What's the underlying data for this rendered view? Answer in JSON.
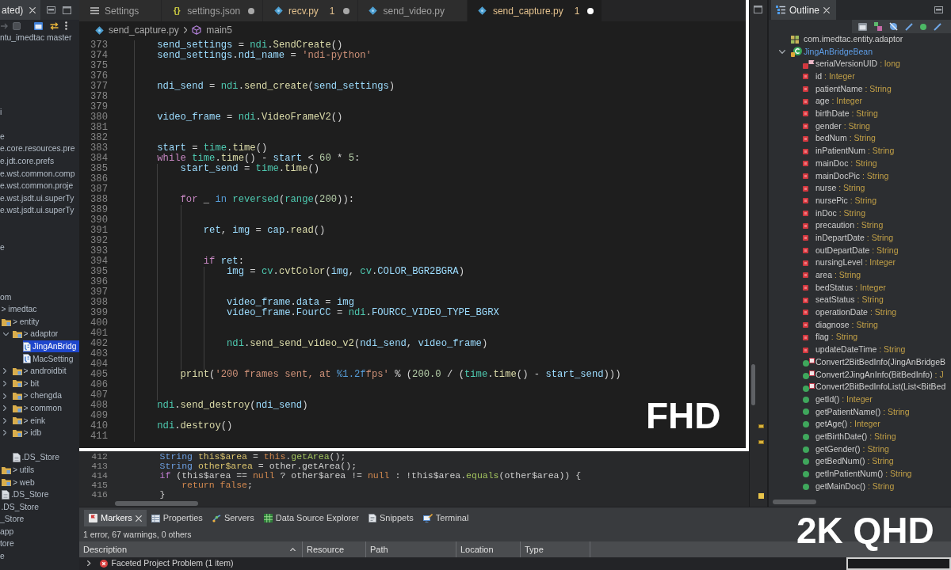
{
  "project_explorer": {
    "tab": {
      "label": "ated)"
    },
    "tree": [
      {
        "label": "ntu_imedtac master",
        "kind": "text",
        "selected": false
      },
      {
        "label": "i",
        "kind": "text",
        "selected": false
      },
      {
        "label": "e",
        "kind": "text",
        "selected": false
      },
      {
        "label": "e.core.resources.pre",
        "kind": "text",
        "selected": false
      },
      {
        "label": "e.jdt.core.prefs",
        "kind": "text",
        "selected": false
      },
      {
        "label": "e.wst.common.comp",
        "kind": "text",
        "selected": false
      },
      {
        "label": "e.wst.common.proje",
        "kind": "text",
        "selected": false
      },
      {
        "label": "e.wst.jsdt.ui.superTy",
        "kind": "text",
        "selected": false
      },
      {
        "label": "e.wst.jsdt.ui.superTy",
        "kind": "text",
        "selected": false
      },
      {
        "label": "e",
        "kind": "text",
        "selected": false
      },
      {
        "label": "om",
        "kind": "text",
        "selected": false,
        "children": [
          {
            "label": "> imedtac",
            "kind": "text",
            "selected": false,
            "children": [
              {
                "label": "> entity",
                "kind": "folder",
                "selected": false,
                "children": [
                  {
                    "label": "> adaptor",
                    "kind": "folder",
                    "expanded": true,
                    "selected": false,
                    "children": [
                      {
                        "label": "JingAnBridg",
                        "kind": "java",
                        "selected": true
                      },
                      {
                        "label": "MacSetting",
                        "kind": "java",
                        "selected": false
                      }
                    ]
                  },
                  {
                    "label": "> androidbit",
                    "kind": "folder",
                    "expanded": false,
                    "selected": false
                  },
                  {
                    "label": "> bit",
                    "kind": "folder",
                    "expanded": false,
                    "selected": false
                  },
                  {
                    "label": "> chengda",
                    "kind": "folder",
                    "expanded": false,
                    "selected": false
                  },
                  {
                    "label": "> common",
                    "kind": "folder",
                    "expanded": false,
                    "selected": false
                  },
                  {
                    "label": "> eink",
                    "kind": "folder",
                    "expanded": false,
                    "selected": false
                  },
                  {
                    "label": "> idb",
                    "kind": "folder",
                    "expanded": false,
                    "selected": false
                  },
                  {
                    "label": ".DS_Store",
                    "kind": "file",
                    "selected": false
                  }
                ]
              },
              {
                "label": "> utils",
                "kind": "folder",
                "selected": false
              },
              {
                "label": "> web",
                "kind": "folder",
                "selected": false
              },
              {
                "label": ".DS_Store",
                "kind": "file",
                "selected": false
              }
            ]
          },
          {
            "label": ".DS_Store",
            "kind": "text",
            "selected": false
          }
        ]
      },
      {
        "label": "_Store",
        "kind": "text",
        "selected": false
      },
      {
        "label": "app",
        "kind": "text",
        "selected": false
      },
      {
        "label": "tore",
        "kind": "text",
        "selected": false
      },
      {
        "label": "e",
        "kind": "text",
        "selected": false
      }
    ]
  },
  "editor": {
    "lines": [
      {
        "number": "412",
        "tokens": [
          {
            "text": "    String ",
            "kind": "type"
          },
          {
            "text": "this$area",
            "kind": "local"
          },
          {
            "text": " = ",
            "kind": "plain"
          },
          {
            "text": "this",
            "kind": "keyword"
          },
          {
            "text": ".",
            "kind": "plain"
          },
          {
            "text": "getArea",
            "kind": "method"
          },
          {
            "text": "();",
            "kind": "plain"
          }
        ]
      },
      {
        "number": "413",
        "tokens": [
          {
            "text": "    String ",
            "kind": "type"
          },
          {
            "text": "other$area",
            "kind": "local"
          },
          {
            "text": " = other.getArea();",
            "kind": "plain"
          }
        ]
      },
      {
        "number": "414",
        "tokens": [
          {
            "text": "    if",
            "kind": "control"
          },
          {
            "text": " (this$area == ",
            "kind": "plain"
          },
          {
            "text": "null",
            "kind": "keyword"
          },
          {
            "text": " ? other$area != ",
            "kind": "plain"
          },
          {
            "text": "null",
            "kind": "keyword"
          },
          {
            "text": " : !this$area.",
            "kind": "plain"
          },
          {
            "text": "equals",
            "kind": "method"
          },
          {
            "text": "(other$area)) {",
            "kind": "plain"
          }
        ]
      },
      {
        "number": "415",
        "tokens": [
          {
            "text": "        return false",
            "kind": "keyword"
          },
          {
            "text": ";",
            "kind": "plain"
          }
        ]
      },
      {
        "number": "416",
        "tokens": [
          {
            "text": "    }",
            "kind": "plain"
          }
        ]
      }
    ]
  },
  "outline": {
    "tab": {
      "label": "Outline"
    },
    "tree": [
      {
        "label": "com.imedtac.entity.adaptor",
        "kind": "package",
        "selected": false
      },
      {
        "label": "JingAnBridgeBean",
        "kind": "class",
        "expanded": true,
        "selected": true,
        "children": [
          {
            "label": "serialVersionUID",
            "type": ": long",
            "kind": "static_field",
            "selected": false
          },
          {
            "label": "id",
            "type": ": Integer",
            "kind": "field",
            "selected": false
          },
          {
            "label": "patientName",
            "type": ": String",
            "kind": "field",
            "selected": false
          },
          {
            "label": "age",
            "type": ": Integer",
            "kind": "field",
            "selected": false
          },
          {
            "label": "birthDate",
            "type": ": String",
            "kind": "field",
            "selected": false
          },
          {
            "label": "gender",
            "type": ": String",
            "kind": "field",
            "selected": false
          },
          {
            "label": "bedNum",
            "type": ": String",
            "kind": "field",
            "selected": false
          },
          {
            "label": "inPatientNum",
            "type": ": String",
            "kind": "field",
            "selected": false
          },
          {
            "label": "mainDoc",
            "type": ": String",
            "kind": "field",
            "selected": false
          },
          {
            "label": "mainDocPic",
            "type": ": String",
            "kind": "field",
            "selected": false
          },
          {
            "label": "nurse",
            "type": ": String",
            "kind": "field",
            "selected": false
          },
          {
            "label": "nursePic",
            "type": ": String",
            "kind": "field",
            "selected": false
          },
          {
            "label": "inDoc",
            "type": ": String",
            "kind": "field",
            "selected": false
          },
          {
            "label": "precaution",
            "type": ": String",
            "kind": "field",
            "selected": false
          },
          {
            "label": "inDepartDate",
            "type": ": String",
            "kind": "field",
            "selected": false
          },
          {
            "label": "outDepartDate",
            "type": ": String",
            "kind": "field",
            "selected": false
          },
          {
            "label": "nursingLevel",
            "type": ": Integer",
            "kind": "field",
            "selected": false
          },
          {
            "label": "area",
            "type": ": String",
            "kind": "field",
            "selected": false
          },
          {
            "label": "bedStatus",
            "type": ": Integer",
            "kind": "field",
            "selected": false
          },
          {
            "label": "seatStatus",
            "type": ": String",
            "kind": "field",
            "selected": false
          },
          {
            "label": "operationDate",
            "type": ": String",
            "kind": "field",
            "selected": false
          },
          {
            "label": "diagnose",
            "type": ": String",
            "kind": "field",
            "selected": false
          },
          {
            "label": "flag",
            "type": ": String",
            "kind": "field",
            "selected": false
          },
          {
            "label": "updateDateTime",
            "type": ": String",
            "kind": "field",
            "selected": false
          },
          {
            "label": "Convert2BitBedInfo(JingAnBridgeB",
            "kind": "static_method",
            "selected": false
          },
          {
            "label": "Convert2JingAnInfo(BitBedInfo)",
            "type": ": J",
            "kind": "static_method",
            "selected": false
          },
          {
            "label": "Convert2BitBedInfoList(List<BitBed",
            "kind": "static_method",
            "selected": false
          },
          {
            "label": "getId()",
            "type": ": Integer",
            "kind": "method",
            "selected": false
          },
          {
            "label": "getPatientName()",
            "type": ": String",
            "kind": "method",
            "selected": false
          },
          {
            "label": "getAge()",
            "type": ": Integer",
            "kind": "method",
            "selected": false
          },
          {
            "label": "getBirthDate()",
            "type": ": String",
            "kind": "method",
            "selected": false
          },
          {
            "label": "getGender()",
            "type": ": String",
            "kind": "method",
            "selected": false
          },
          {
            "label": "getBedNum()",
            "type": ": String",
            "kind": "method",
            "selected": false
          },
          {
            "label": "getInPatientNum()",
            "type": ": String",
            "kind": "method",
            "selected": false
          },
          {
            "label": "getMainDoc()",
            "type": ": String",
            "kind": "method",
            "selected": false
          }
        ]
      }
    ]
  },
  "bottom_panel": {
    "tabs": [
      {
        "label": "Markers",
        "kind": "markers",
        "selected": true,
        "closable": true
      },
      {
        "label": "Properties",
        "kind": "properties",
        "selected": false,
        "closable": false
      },
      {
        "label": "Servers",
        "kind": "servers",
        "selected": false,
        "closable": false
      },
      {
        "label": "Data Source Explorer",
        "kind": "database",
        "selected": false,
        "closable": false
      },
      {
        "label": "Snippets",
        "kind": "snippets",
        "selected": false,
        "closable": false
      },
      {
        "label": "Terminal",
        "kind": "terminal",
        "selected": false,
        "closable": false
      }
    ],
    "summary": "1 error, 67 warnings, 0 others",
    "columns": [
      {
        "label": "Description",
        "sorted": true
      },
      {
        "label": "Resource",
        "sorted": false
      },
      {
        "label": "Path",
        "sorted": false
      },
      {
        "label": "Location",
        "sorted": false
      },
      {
        "label": "Type",
        "sorted": false
      }
    ],
    "rows": [
      {
        "description": "Faceted Project Problem (1 item)",
        "kind": "error",
        "expanded": false
      }
    ]
  },
  "vscode": {
    "tabs": [
      {
        "label": "Settings",
        "kind": "settings",
        "selected": false,
        "warning": false,
        "unsaved": false
      },
      {
        "label": "settings.json",
        "kind": "json",
        "glyph": "{}",
        "selected": false,
        "warning": false,
        "unsaved": true
      },
      {
        "label": "recv.py",
        "kind": "python",
        "problems": "1",
        "selected": false,
        "warning": true,
        "unsaved": true
      },
      {
        "label": "send_video.py",
        "kind": "python",
        "selected": false,
        "warning": false,
        "unsaved": false
      },
      {
        "label": "send_capture.py",
        "kind": "python",
        "problems": "1",
        "selected": true,
        "warning": true,
        "unsaved": true
      }
    ],
    "breadcrumb": {
      "file": "send_capture.py",
      "symbol": "main5"
    },
    "lines": [
      {
        "number": "373",
        "tokens": [
          {
            "text": "    send_settings",
            "kind": "var"
          },
          {
            "text": " = ",
            "kind": "op"
          },
          {
            "text": "ndi",
            "kind": "mod"
          },
          {
            "text": ".",
            "kind": "op"
          },
          {
            "text": "SendCreate",
            "kind": "fn"
          },
          {
            "text": "()",
            "kind": "op"
          }
        ]
      },
      {
        "number": "374",
        "tokens": [
          {
            "text": "    send_settings",
            "kind": "var"
          },
          {
            "text": ".",
            "kind": "op"
          },
          {
            "text": "ndi_name",
            "kind": "var"
          },
          {
            "text": " = ",
            "kind": "op"
          },
          {
            "text": "'ndi-python'",
            "kind": "str"
          }
        ]
      },
      {
        "number": "375"
      },
      {
        "number": "376"
      },
      {
        "number": "377",
        "tokens": [
          {
            "text": "    ndi_send",
            "kind": "var"
          },
          {
            "text": " = ",
            "kind": "op"
          },
          {
            "text": "ndi",
            "kind": "mod"
          },
          {
            "text": ".",
            "kind": "op"
          },
          {
            "text": "send_create",
            "kind": "fn"
          },
          {
            "text": "(",
            "kind": "op"
          },
          {
            "text": "send_settings",
            "kind": "var"
          },
          {
            "text": ")",
            "kind": "op"
          }
        ]
      },
      {
        "number": "378"
      },
      {
        "number": "379"
      },
      {
        "number": "380",
        "tokens": [
          {
            "text": "    video_frame",
            "kind": "var"
          },
          {
            "text": " = ",
            "kind": "op"
          },
          {
            "text": "ndi",
            "kind": "mod"
          },
          {
            "text": ".",
            "kind": "op"
          },
          {
            "text": "VideoFrameV2",
            "kind": "fn"
          },
          {
            "text": "()",
            "kind": "op"
          }
        ]
      },
      {
        "number": "381"
      },
      {
        "number": "382"
      },
      {
        "number": "383",
        "tokens": [
          {
            "text": "    start",
            "kind": "var"
          },
          {
            "text": " = ",
            "kind": "op"
          },
          {
            "text": "time",
            "kind": "mod"
          },
          {
            "text": ".",
            "kind": "op"
          },
          {
            "text": "time",
            "kind": "fn"
          },
          {
            "text": "()",
            "kind": "op"
          }
        ]
      },
      {
        "number": "384",
        "tokens": [
          {
            "text": "    while ",
            "kind": "kw"
          },
          {
            "text": "time",
            "kind": "mod"
          },
          {
            "text": ".",
            "kind": "op"
          },
          {
            "text": "time",
            "kind": "fn"
          },
          {
            "text": "() - ",
            "kind": "op"
          },
          {
            "text": "start",
            "kind": "var"
          },
          {
            "text": " < ",
            "kind": "op"
          },
          {
            "text": "60",
            "kind": "num"
          },
          {
            "text": " * ",
            "kind": "op"
          },
          {
            "text": "5",
            "kind": "num"
          },
          {
            "text": ":",
            "kind": "op"
          }
        ]
      },
      {
        "number": "385",
        "tokens": [
          {
            "text": "        start_send",
            "kind": "var"
          },
          {
            "text": " = ",
            "kind": "op"
          },
          {
            "text": "time",
            "kind": "mod"
          },
          {
            "text": ".",
            "kind": "op"
          },
          {
            "text": "time",
            "kind": "fn"
          },
          {
            "text": "()",
            "kind": "op"
          }
        ]
      },
      {
        "number": "386"
      },
      {
        "number": "387"
      },
      {
        "number": "388",
        "tokens": [
          {
            "text": "        for",
            "kind": "kw"
          },
          {
            "text": " _ ",
            "kind": "op"
          },
          {
            "text": "in ",
            "kind": "kw2"
          },
          {
            "text": "reversed",
            "kind": "mod"
          },
          {
            "text": "(",
            "kind": "op"
          },
          {
            "text": "range",
            "kind": "mod"
          },
          {
            "text": "(",
            "kind": "op"
          },
          {
            "text": "200",
            "kind": "num"
          },
          {
            "text": ")):",
            "kind": "op"
          }
        ]
      },
      {
        "number": "389"
      },
      {
        "number": "390"
      },
      {
        "number": "391",
        "tokens": [
          {
            "text": "            ret",
            "kind": "var"
          },
          {
            "text": ", ",
            "kind": "op"
          },
          {
            "text": "img",
            "kind": "var"
          },
          {
            "text": " = ",
            "kind": "op"
          },
          {
            "text": "cap",
            "kind": "var"
          },
          {
            "text": ".",
            "kind": "op"
          },
          {
            "text": "read",
            "kind": "fn"
          },
          {
            "text": "()",
            "kind": "op"
          }
        ]
      },
      {
        "number": "392"
      },
      {
        "number": "393"
      },
      {
        "number": "394",
        "tokens": [
          {
            "text": "            if ",
            "kind": "kw"
          },
          {
            "text": "ret",
            "kind": "var"
          },
          {
            "text": ":",
            "kind": "op"
          }
        ]
      },
      {
        "number": "395",
        "tokens": [
          {
            "text": "                img",
            "kind": "var"
          },
          {
            "text": " = ",
            "kind": "op"
          },
          {
            "text": "cv",
            "kind": "mod"
          },
          {
            "text": ".",
            "kind": "op"
          },
          {
            "text": "cvtColor",
            "kind": "fn"
          },
          {
            "text": "(",
            "kind": "op"
          },
          {
            "text": "img",
            "kind": "var"
          },
          {
            "text": ", ",
            "kind": "op"
          },
          {
            "text": "cv",
            "kind": "mod"
          },
          {
            "text": ".",
            "kind": "op"
          },
          {
            "text": "COLOR_BGR2BGRA",
            "kind": "var"
          },
          {
            "text": ")",
            "kind": "op"
          }
        ]
      },
      {
        "number": "396"
      },
      {
        "number": "397"
      },
      {
        "number": "398",
        "tokens": [
          {
            "text": "                video_frame",
            "kind": "var"
          },
          {
            "text": ".",
            "kind": "op"
          },
          {
            "text": "data",
            "kind": "var"
          },
          {
            "text": " = ",
            "kind": "op"
          },
          {
            "text": "img",
            "kind": "var"
          }
        ]
      },
      {
        "number": "399",
        "tokens": [
          {
            "text": "                video_frame",
            "kind": "var"
          },
          {
            "text": ".",
            "kind": "op"
          },
          {
            "text": "FourCC",
            "kind": "var"
          },
          {
            "text": " = ",
            "kind": "op"
          },
          {
            "text": "ndi",
            "kind": "mod"
          },
          {
            "text": ".",
            "kind": "op"
          },
          {
            "text": "FOURCC_VIDEO_TYPE_BGRX",
            "kind": "var"
          }
        ]
      },
      {
        "number": "400"
      },
      {
        "number": "401"
      },
      {
        "number": "402",
        "tokens": [
          {
            "text": "                ndi",
            "kind": "mod"
          },
          {
            "text": ".",
            "kind": "op"
          },
          {
            "text": "send_send_video_v2",
            "kind": "fn"
          },
          {
            "text": "(",
            "kind": "op"
          },
          {
            "text": "ndi_send",
            "kind": "var"
          },
          {
            "text": ", ",
            "kind": "op"
          },
          {
            "text": "video_frame",
            "kind": "var"
          },
          {
            "text": ")",
            "kind": "op"
          }
        ]
      },
      {
        "number": "403"
      },
      {
        "number": "404"
      },
      {
        "number": "405",
        "tokens": [
          {
            "text": "        print",
            "kind": "fn"
          },
          {
            "text": "(",
            "kind": "op"
          },
          {
            "text": "'200 frames sent, at ",
            "kind": "str"
          },
          {
            "text": "%1.2f",
            "kind": "kw2"
          },
          {
            "text": "fps'",
            "kind": "str"
          },
          {
            "text": " % (",
            "kind": "op"
          },
          {
            "text": "200.0",
            "kind": "num"
          },
          {
            "text": " / (",
            "kind": "op"
          },
          {
            "text": "time",
            "kind": "mod"
          },
          {
            "text": ".",
            "kind": "op"
          },
          {
            "text": "time",
            "kind": "fn"
          },
          {
            "text": "() - ",
            "kind": "op"
          },
          {
            "text": "start_send",
            "kind": "var"
          },
          {
            "text": ")))",
            "kind": "op"
          }
        ]
      },
      {
        "number": "406"
      },
      {
        "number": "407"
      },
      {
        "number": "408",
        "tokens": [
          {
            "text": "    ndi",
            "kind": "mod"
          },
          {
            "text": ".",
            "kind": "op"
          },
          {
            "text": "send_destroy",
            "kind": "fn"
          },
          {
            "text": "(",
            "kind": "op"
          },
          {
            "text": "ndi_send",
            "kind": "var"
          },
          {
            "text": ")",
            "kind": "op"
          }
        ]
      },
      {
        "number": "409"
      },
      {
        "number": "410",
        "tokens": [
          {
            "text": "    ndi",
            "kind": "mod"
          },
          {
            "text": ".",
            "kind": "op"
          },
          {
            "text": "destroy",
            "kind": "fn"
          },
          {
            "text": "()",
            "kind": "op"
          }
        ]
      },
      {
        "number": "411"
      }
    ],
    "resolution_label": "FHD"
  },
  "resolution_label": "2K QHD"
}
